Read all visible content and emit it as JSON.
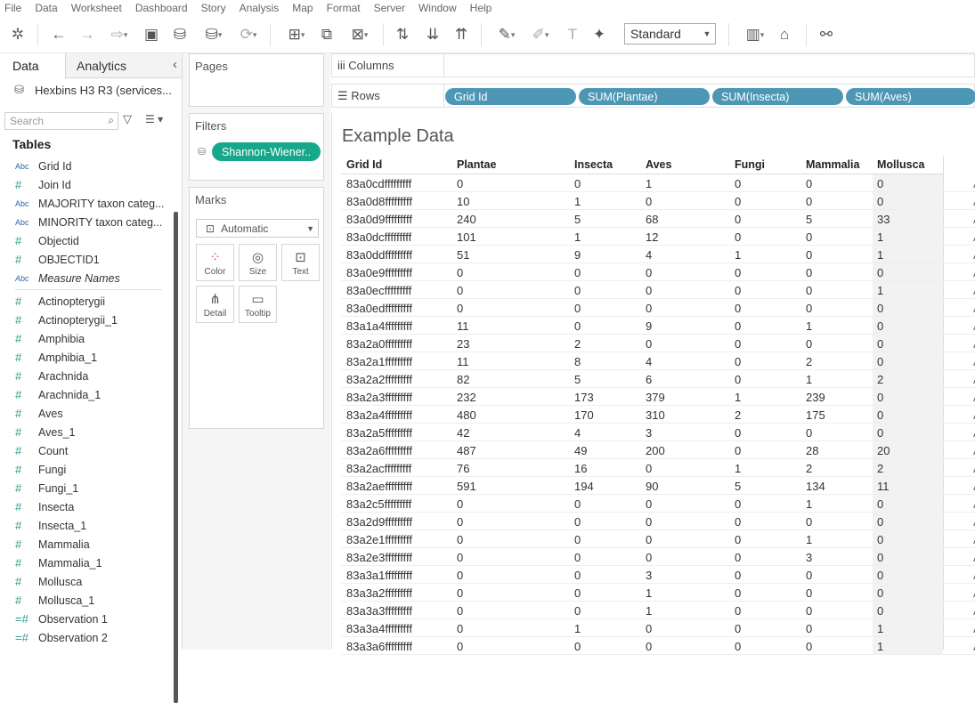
{
  "menu": [
    "File",
    "Data",
    "Worksheet",
    "Dashboard",
    "Story",
    "Analysis",
    "Map",
    "Format",
    "Server",
    "Window",
    "Help"
  ],
  "toolbar": {
    "view_mode": "Standard"
  },
  "left_pane": {
    "tab_data": "Data",
    "tab_analytics": "Analytics",
    "datasource": "Hexbins H3 R3 (services...",
    "search_placeholder": "Search",
    "tables_heading": "Tables",
    "fields": [
      {
        "type": "Abc",
        "name": "Grid Id"
      },
      {
        "type": "#",
        "name": "Join Id"
      },
      {
        "type": "Abc",
        "name": "MAJORITY taxon categ..."
      },
      {
        "type": "Abc",
        "name": "MINORITY taxon categ..."
      },
      {
        "type": "#",
        "name": "Objectid"
      },
      {
        "type": "#",
        "name": "OBJECTID1"
      },
      {
        "type": "Abc",
        "name": "Measure Names"
      }
    ],
    "measures": [
      {
        "type": "#",
        "name": "Actinopterygii"
      },
      {
        "type": "#",
        "name": "Actinopterygii_1"
      },
      {
        "type": "#",
        "name": "Amphibia"
      },
      {
        "type": "#",
        "name": "Amphibia_1"
      },
      {
        "type": "#",
        "name": "Arachnida"
      },
      {
        "type": "#",
        "name": "Arachnida_1"
      },
      {
        "type": "#",
        "name": "Aves"
      },
      {
        "type": "#",
        "name": "Aves_1"
      },
      {
        "type": "#",
        "name": "Count"
      },
      {
        "type": "#",
        "name": "Fungi"
      },
      {
        "type": "#",
        "name": "Fungi_1"
      },
      {
        "type": "#",
        "name": "Insecta"
      },
      {
        "type": "#",
        "name": "Insecta_1"
      },
      {
        "type": "#",
        "name": "Mammalia"
      },
      {
        "type": "#",
        "name": "Mammalia_1"
      },
      {
        "type": "#",
        "name": "Mollusca"
      },
      {
        "type": "#",
        "name": "Mollusca_1"
      },
      {
        "type": "=#",
        "name": "Observation 1"
      },
      {
        "type": "=#",
        "name": "Observation 2"
      }
    ]
  },
  "cards": {
    "pages": "Pages",
    "filters": "Filters",
    "filter_pill": "Shannon-Wiener..",
    "marks": "Marks",
    "mark_type": "Automatic",
    "mark_buttons": [
      "Color",
      "Size",
      "Text",
      "Detail",
      "Tooltip"
    ]
  },
  "shelves": {
    "columns": "Columns",
    "rows": "Rows",
    "row_pills": [
      "Grid Id",
      "SUM(Plantae)",
      "SUM(Insecta)",
      "SUM(Aves)"
    ]
  },
  "view": {
    "title": "Example Data",
    "columns": [
      "Grid Id",
      "Plantae",
      "Insecta",
      "Aves",
      "Fungi",
      "Mammalia",
      "Mollusca"
    ],
    "edge_text": "A",
    "rows": [
      [
        "83a0cdfffffffff",
        "0",
        "0",
        "1",
        "0",
        "0",
        "0"
      ],
      [
        "83a0d8fffffffff",
        "10",
        "1",
        "0",
        "0",
        "0",
        "0"
      ],
      [
        "83a0d9fffffffff",
        "240",
        "5",
        "68",
        "0",
        "5",
        "33"
      ],
      [
        "83a0dcfffffffff",
        "101",
        "1",
        "12",
        "0",
        "0",
        "1"
      ],
      [
        "83a0ddfffffffff",
        "51",
        "9",
        "4",
        "1",
        "0",
        "1"
      ],
      [
        "83a0e9fffffffff",
        "0",
        "0",
        "0",
        "0",
        "0",
        "0"
      ],
      [
        "83a0ecfffffffff",
        "0",
        "0",
        "0",
        "0",
        "0",
        "1"
      ],
      [
        "83a0edfffffffff",
        "0",
        "0",
        "0",
        "0",
        "0",
        "0"
      ],
      [
        "83a1a4fffffffff",
        "11",
        "0",
        "9",
        "0",
        "1",
        "0"
      ],
      [
        "83a2a0fffffffff",
        "23",
        "2",
        "0",
        "0",
        "0",
        "0"
      ],
      [
        "83a2a1fffffffff",
        "11",
        "8",
        "4",
        "0",
        "2",
        "0"
      ],
      [
        "83a2a2fffffffff",
        "82",
        "5",
        "6",
        "0",
        "1",
        "2"
      ],
      [
        "83a2a3fffffffff",
        "232",
        "173",
        "379",
        "1",
        "239",
        "0"
      ],
      [
        "83a2a4fffffffff",
        "480",
        "170",
        "310",
        "2",
        "175",
        "0"
      ],
      [
        "83a2a5fffffffff",
        "42",
        "4",
        "3",
        "0",
        "0",
        "0"
      ],
      [
        "83a2a6fffffffff",
        "487",
        "49",
        "200",
        "0",
        "28",
        "20"
      ],
      [
        "83a2acfffffffff",
        "76",
        "16",
        "0",
        "1",
        "2",
        "2"
      ],
      [
        "83a2aefffffffff",
        "591",
        "194",
        "90",
        "5",
        "134",
        "11"
      ],
      [
        "83a2c5fffffffff",
        "0",
        "0",
        "0",
        "0",
        "1",
        "0"
      ],
      [
        "83a2d9fffffffff",
        "0",
        "0",
        "0",
        "0",
        "0",
        "0"
      ],
      [
        "83a2e1fffffffff",
        "0",
        "0",
        "0",
        "0",
        "1",
        "0"
      ],
      [
        "83a2e3fffffffff",
        "0",
        "0",
        "0",
        "0",
        "3",
        "0"
      ],
      [
        "83a3a1fffffffff",
        "0",
        "0",
        "3",
        "0",
        "0",
        "0"
      ],
      [
        "83a3a2fffffffff",
        "0",
        "0",
        "1",
        "0",
        "0",
        "0"
      ],
      [
        "83a3a3fffffffff",
        "0",
        "0",
        "1",
        "0",
        "0",
        "0"
      ],
      [
        "83a3a4fffffffff",
        "0",
        "1",
        "0",
        "0",
        "0",
        "1"
      ],
      [
        "83a3a6fffffffff",
        "0",
        "0",
        "0",
        "0",
        "0",
        "1"
      ]
    ]
  }
}
